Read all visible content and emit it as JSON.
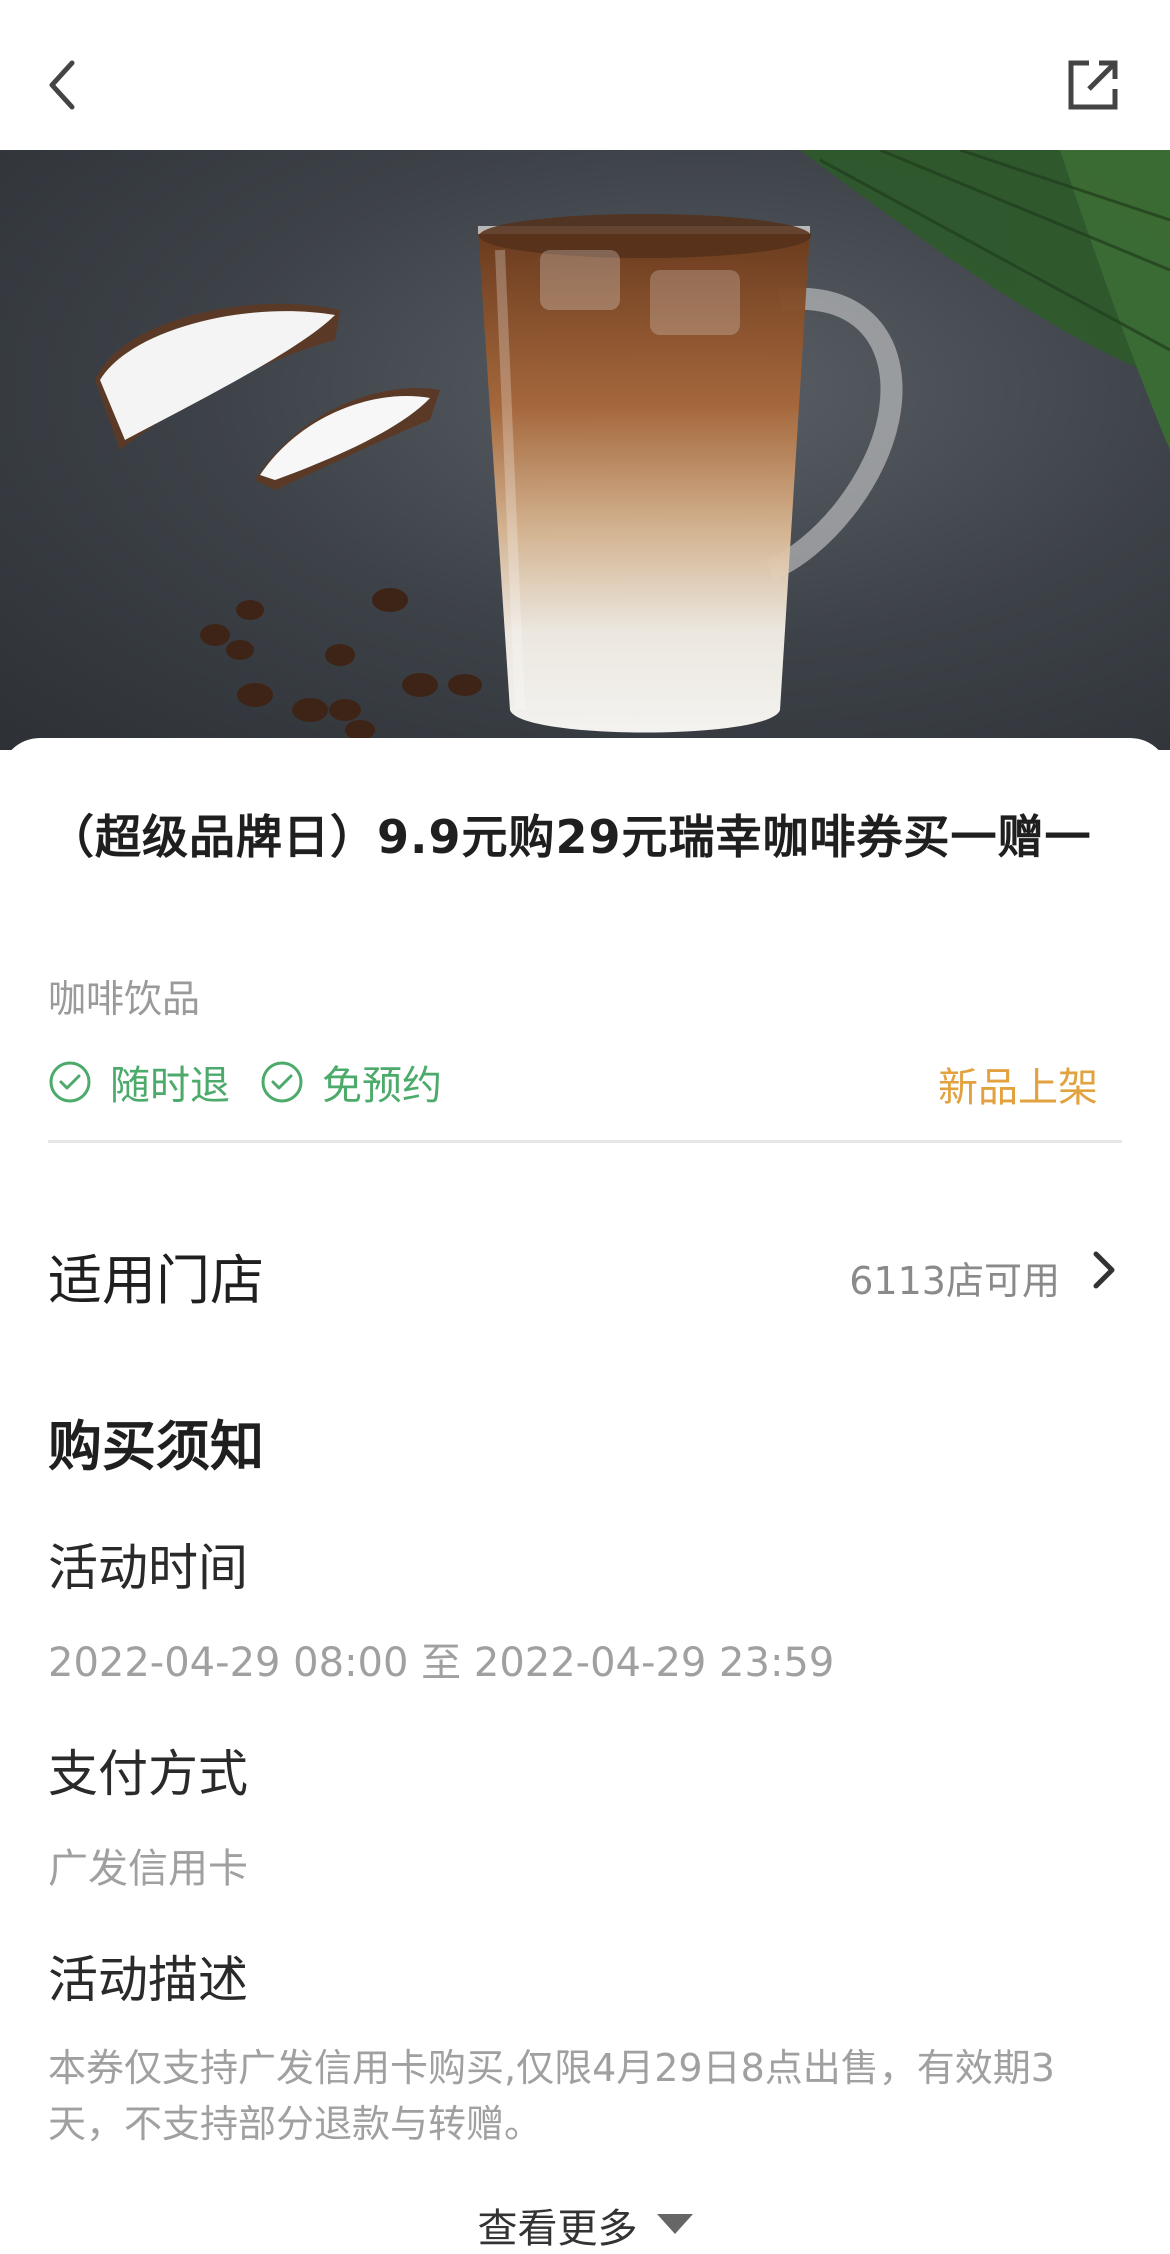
{
  "header": {
    "back_icon": "back-icon",
    "share_icon": "share-icon"
  },
  "product": {
    "title": "（超级品牌日）9.9元购29元瑞幸咖啡券买一赠一",
    "category": "咖啡饮品",
    "tags": [
      "随时退",
      "免预约"
    ],
    "badge": "新品上架"
  },
  "stores": {
    "label": "适用门店",
    "count": "6113店可用"
  },
  "notice": {
    "title": "购买须知",
    "activity_time_label": "活动时间",
    "activity_time": "2022-04-29 08:00 至 2022-04-29 23:59",
    "payment_label": "支付方式",
    "payment": "广发信用卡",
    "description_label": "活动描述",
    "description": "本券仅支持广发信用卡购买,仅限4月29日8点出售，有效期3天，不支持部分退款与转赠。"
  },
  "more": {
    "label": "查看更多"
  },
  "colors": {
    "green": "#4caa6a",
    "orange": "#e2a23f"
  }
}
